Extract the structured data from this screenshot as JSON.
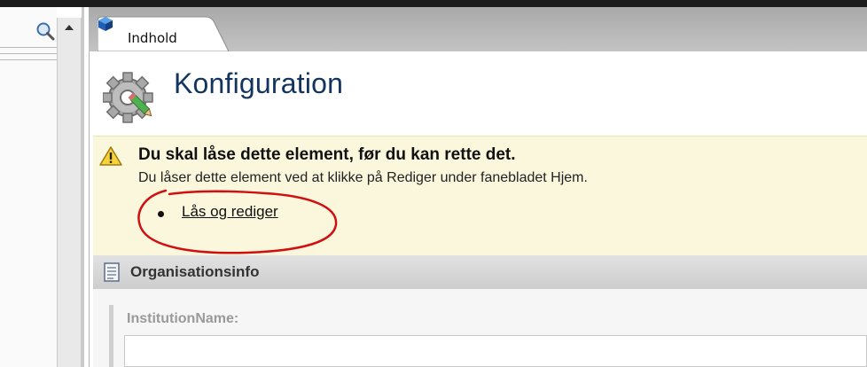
{
  "tab": {
    "label": "Indhold"
  },
  "page": {
    "title": "Konfiguration"
  },
  "warning": {
    "title": "Du skal låse dette element, før du kan rette det.",
    "text": "Du låser dette element ved at klikke på Rediger under fanebladet Hjem.",
    "link_label": "Lås og rediger"
  },
  "section": {
    "title": "Organisationsinfo"
  },
  "field": {
    "label": "InstitutionName:",
    "value": ""
  },
  "icons": {
    "search": "search-icon",
    "tab": "cube-icon",
    "header": "gear-pencil-icon",
    "warning": "warning-icon",
    "section": "document-icon"
  },
  "colors": {
    "title": "#12345f",
    "warning_bg": "#fbf7dd",
    "annotation": "#d01010"
  }
}
